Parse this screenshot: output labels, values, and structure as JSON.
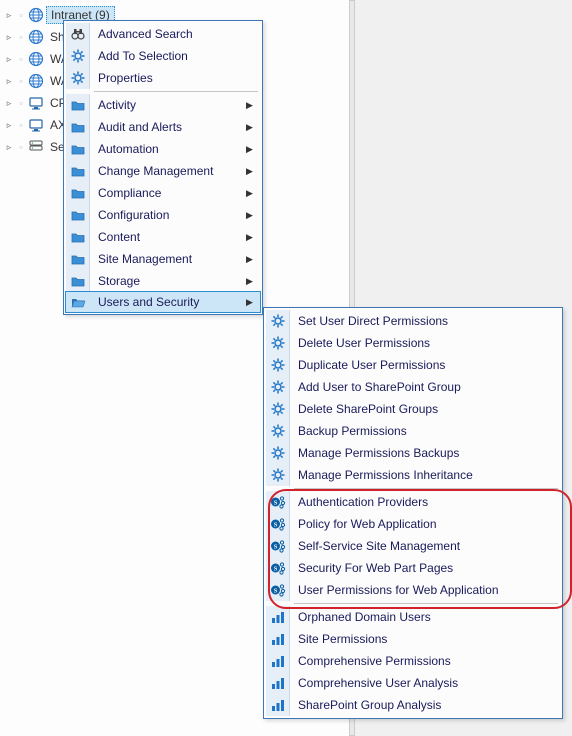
{
  "tree": {
    "items": [
      {
        "label": "Intranet (9)",
        "icon": "globe",
        "selected": true
      },
      {
        "label": "Sha",
        "icon": "globe"
      },
      {
        "label": "WAF",
        "icon": "globe"
      },
      {
        "label": "WAF",
        "icon": "globe"
      },
      {
        "label": "CP-",
        "icon": "monitor"
      },
      {
        "label": "AXD",
        "icon": "monitor"
      },
      {
        "label": "Serv",
        "icon": "server"
      }
    ]
  },
  "menu1": {
    "section1": [
      {
        "label": "Advanced Search",
        "icon": "binoculars"
      },
      {
        "label": "Add To Selection",
        "icon": "gear"
      },
      {
        "label": "Properties",
        "icon": "gear"
      }
    ],
    "section2": [
      {
        "label": "Activity",
        "icon": "folder",
        "submenu": true
      },
      {
        "label": "Audit and Alerts",
        "icon": "folder",
        "submenu": true
      },
      {
        "label": "Automation",
        "icon": "folder",
        "submenu": true
      },
      {
        "label": "Change Management",
        "icon": "folder",
        "submenu": true
      },
      {
        "label": "Compliance",
        "icon": "folder",
        "submenu": true
      },
      {
        "label": "Configuration",
        "icon": "folder",
        "submenu": true
      },
      {
        "label": "Content",
        "icon": "folder",
        "submenu": true
      },
      {
        "label": "Site Management",
        "icon": "folder",
        "submenu": true
      },
      {
        "label": "Storage",
        "icon": "folder",
        "submenu": true
      },
      {
        "label": "Users and Security",
        "icon": "folder-open",
        "submenu": true,
        "hover": true
      }
    ]
  },
  "menu2": {
    "section1": [
      {
        "label": "Set User Direct Permissions",
        "icon": "gear"
      },
      {
        "label": "Delete User Permissions",
        "icon": "gear"
      },
      {
        "label": "Duplicate User Permissions",
        "icon": "gear"
      },
      {
        "label": "Add User to SharePoint Group",
        "icon": "gear"
      },
      {
        "label": "Delete SharePoint Groups",
        "icon": "gear"
      },
      {
        "label": "Backup Permissions",
        "icon": "gear"
      },
      {
        "label": "Manage Permissions Backups",
        "icon": "gear"
      },
      {
        "label": "Manage Permissions Inheritance",
        "icon": "gear"
      }
    ],
    "section2": [
      {
        "label": "Authentication Providers",
        "icon": "sp"
      },
      {
        "label": "Policy for Web Application",
        "icon": "sp"
      },
      {
        "label": "Self-Service Site Management",
        "icon": "sp"
      },
      {
        "label": "Security For Web Part Pages",
        "icon": "sp"
      },
      {
        "label": "User Permissions for Web Application",
        "icon": "sp"
      }
    ],
    "section3": [
      {
        "label": "Orphaned Domain Users",
        "icon": "chart"
      },
      {
        "label": "Site Permissions",
        "icon": "chart"
      },
      {
        "label": "Comprehensive Permissions",
        "icon": "chart"
      },
      {
        "label": "Comprehensive User Analysis",
        "icon": "chart"
      },
      {
        "label": "SharePoint Group Analysis",
        "icon": "chart"
      }
    ]
  }
}
